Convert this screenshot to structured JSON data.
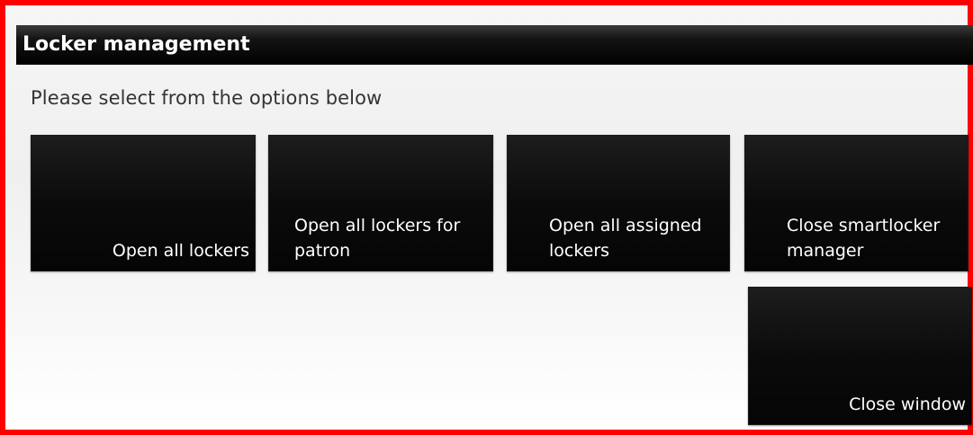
{
  "window": {
    "title": "Locker management"
  },
  "main": {
    "instruction": "Please select from the options below",
    "options": [
      {
        "label": "Open all lockers"
      },
      {
        "label": "Open all lockers for\npatron"
      },
      {
        "label": "Open all assigned\nlockers"
      },
      {
        "label": "Close smartlocker\nmanager"
      },
      {
        "label": "Close window"
      }
    ]
  },
  "colors": {
    "border": "#ff0000",
    "tile_background": "#0b0b0b",
    "tile_text": "#ffffff",
    "titlebar_background": "#000000"
  }
}
